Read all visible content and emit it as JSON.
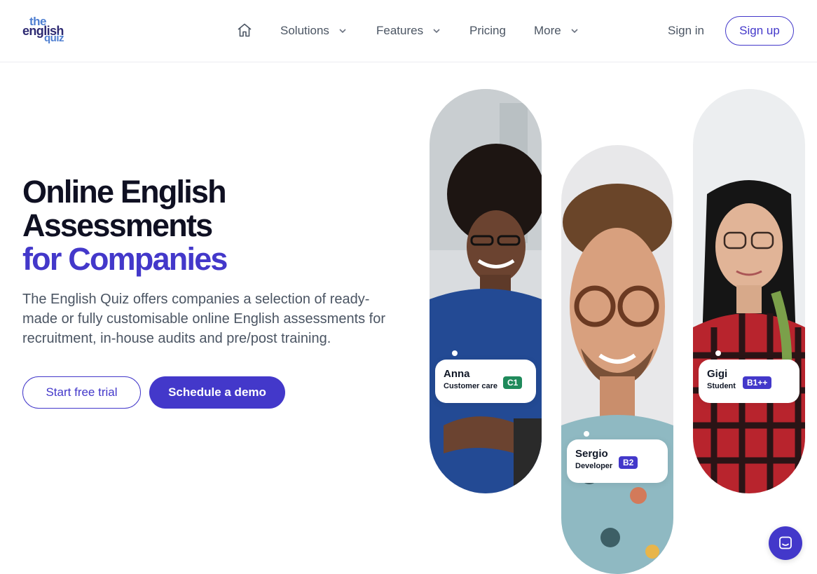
{
  "logo": {
    "line1": "the",
    "line2": "english",
    "line3": "quiz"
  },
  "nav": {
    "items": [
      {
        "label": "Solutions",
        "has_dropdown": true
      },
      {
        "label": "Features",
        "has_dropdown": true
      },
      {
        "label": "Pricing",
        "has_dropdown": false
      },
      {
        "label": "More",
        "has_dropdown": true
      }
    ],
    "sign_in": "Sign in",
    "sign_up": "Sign up"
  },
  "hero": {
    "title_line1": "Online English",
    "title_line2": "Assessments",
    "title_accent": "for Companies",
    "description": "The English Quiz offers companies a selection of ready-made or fully customisable online English assessments for recruitment, in-house audits and pre/post training.",
    "cta_primary": "Start free trial",
    "cta_secondary": "Schedule a demo"
  },
  "people": [
    {
      "name": "Anna",
      "role": "Customer care",
      "level": "C1",
      "level_color": "#1f8a5b"
    },
    {
      "name": "Sergio",
      "role": "Developer",
      "level": "B2",
      "level_color": "#4338ca"
    },
    {
      "name": "Gigi",
      "role": "Student",
      "level": "B1++",
      "level_color": "#4338ca"
    }
  ],
  "icons": {
    "home": "home-icon",
    "chevron": "chevron-down-icon",
    "chat": "chat-launcher-icon"
  },
  "colors": {
    "accent": "#4338ca",
    "text_dark": "#0f1022",
    "text_muted": "#4b5563",
    "badge_green": "#1f8a5b"
  }
}
